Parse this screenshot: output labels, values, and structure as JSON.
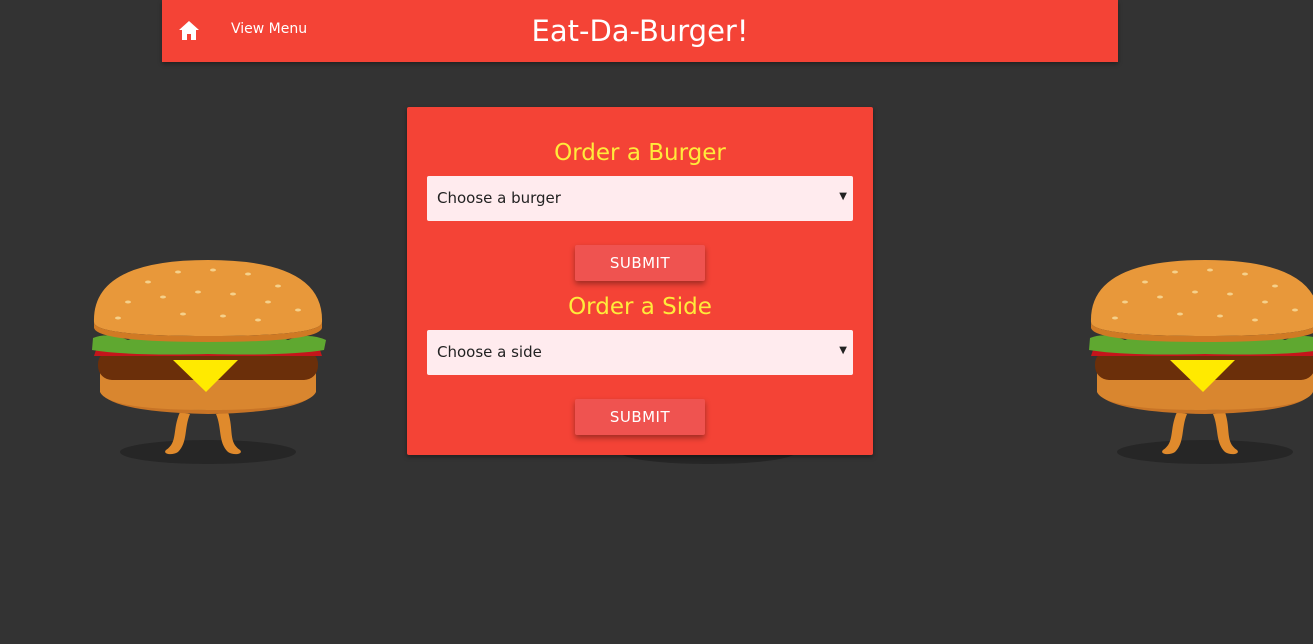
{
  "navbar": {
    "home_icon": "home-icon",
    "view_menu_label": "View Menu",
    "brand_title": "Eat-Da-Burger!"
  },
  "order_form": {
    "burger_section_title": "Order a Burger",
    "burger_select_value": "Choose a burger",
    "burger_submit_label": "SUBMIT",
    "side_section_title": "Order a Side",
    "side_select_value": "Choose a side",
    "side_submit_label": "SUBMIT"
  },
  "colors": {
    "background": "#333333",
    "brand_red": "#f44336",
    "title_yellow": "#ffeb3b",
    "select_bg": "#ffebee",
    "button_red": "#ef5350"
  }
}
